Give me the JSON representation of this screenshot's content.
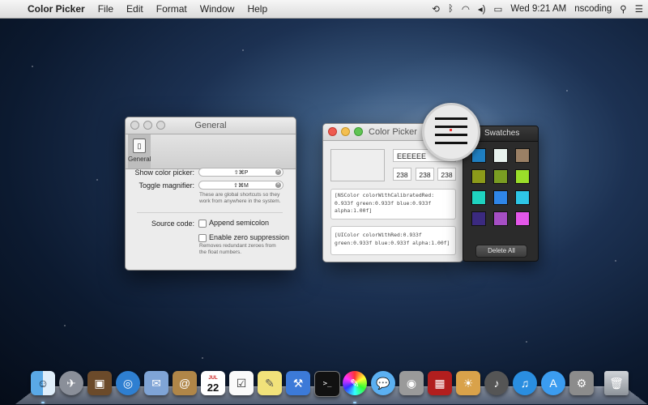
{
  "menubar": {
    "apple": "",
    "app_name": "Color Picker",
    "items": [
      "File",
      "Edit",
      "Format",
      "Window",
      "Help"
    ],
    "clock": "Wed 9:21 AM",
    "user": "nscoding"
  },
  "general_window": {
    "title": "General",
    "toolbar_button": "General",
    "show_color_picker_label": "Show color picker:",
    "show_color_picker_shortcut": "⇧⌘P",
    "toggle_magnifier_label": "Toggle magnifier:",
    "toggle_magnifier_shortcut": "⇧⌘M",
    "shortcut_hint_1": "These are global shortcuts so they",
    "shortcut_hint_2": "work from anywhere in the system.",
    "source_code_label": "Source code:",
    "append_semicolon": "Append semicolon",
    "append_semicolon_checked": false,
    "zero_suppression": "Enable zero suppression",
    "zero_suppression_checked": false,
    "zero_hint_1": "Removes redundant zeroes from",
    "zero_hint_2": "the float numbers."
  },
  "color_picker_window": {
    "title": "Color Picker",
    "current_color": "#eeeeee",
    "hex": "EEEEEE",
    "r": "238",
    "g": "238",
    "b": "238",
    "nscolor_1": "[NSColor colorWithCalibratedRed:",
    "nscolor_2": "0.933f green:0.933f blue:0.933f",
    "nscolor_3": "alpha:1.00f]",
    "uicolor_1": "[UIColor colorWithRed:0.933f",
    "uicolor_2": "green:0.933f blue:0.933f alpha:1.00f]"
  },
  "swatches_window": {
    "title": "Swatches",
    "delete_all": "Delete All",
    "colors": [
      "#1f7fc1",
      "#e8f2ee",
      "#9a8065",
      "#8c9a1a",
      "#7a9d22",
      "#9ade2a",
      "#1fd3c0",
      "#2f86e8",
      "#2ec6e6",
      "#3b2a80",
      "#a64fc4",
      "#e457e9"
    ]
  },
  "dock": {
    "icons": [
      "finder-icon",
      "launchpad-icon",
      "image-capture-icon",
      "safari-icon",
      "mail-icon",
      "contacts-icon",
      "calendar-icon",
      "reminders-icon",
      "notes-icon",
      "xcode-icon",
      "terminal-icon",
      "color-picker-icon",
      "messages-icon",
      "facetime-icon",
      "photo-booth-icon",
      "iphoto-icon",
      "garageband-icon",
      "itunes-icon",
      "app-store-icon",
      "system-preferences-icon",
      "trash-icon"
    ],
    "calendar_day": "22",
    "calendar_month": "JUL"
  }
}
